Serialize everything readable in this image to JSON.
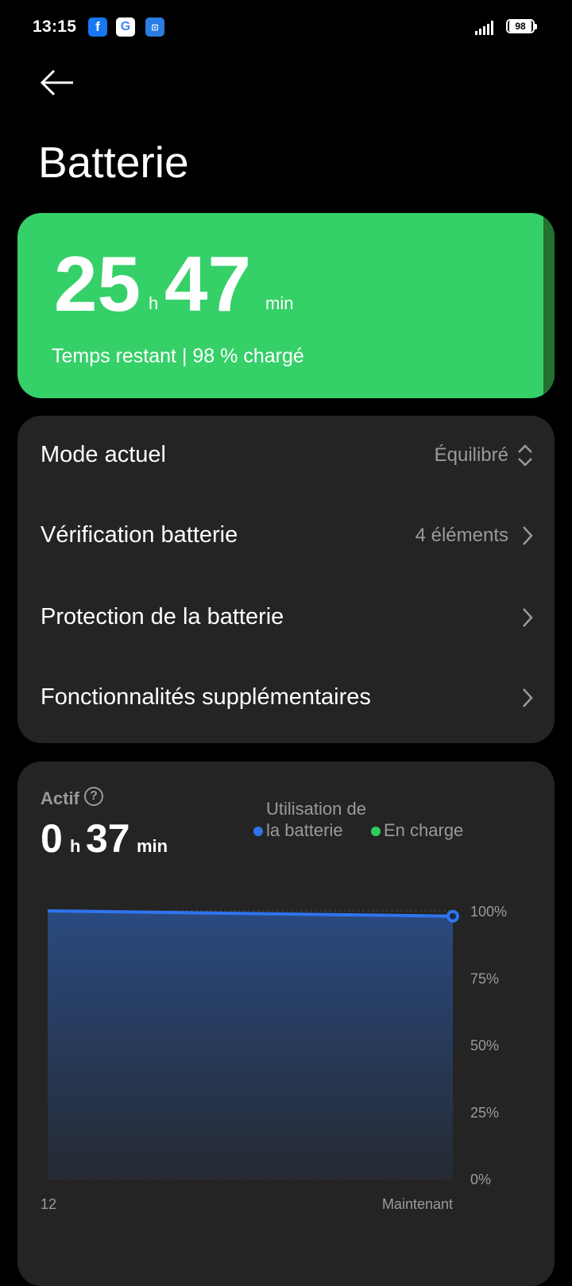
{
  "status_bar": {
    "time": "13:15",
    "battery_level": "98"
  },
  "page": {
    "title": "Batterie"
  },
  "summary": {
    "hours": "25",
    "hours_unit": "h",
    "minutes": "47",
    "minutes_unit": "min",
    "subtitle": "Temps restant | 98 % chargé"
  },
  "settings": [
    {
      "label": "Mode actuel",
      "value": "Équilibré"
    },
    {
      "label": "Vérification batterie",
      "value": "4 éléments"
    },
    {
      "label": "Protection de la batterie",
      "value": ""
    },
    {
      "label": "Fonctionnalités supplémentaires",
      "value": ""
    }
  ],
  "usage": {
    "label": "Actif",
    "hours": "0",
    "hours_unit": "h",
    "minutes": "37",
    "minutes_unit": "min",
    "legend_usage": "Utilisation de la batterie",
    "legend_charging": "En charge"
  },
  "colors": {
    "accent_green": "#35d068",
    "usage_blue": "#2f74ee",
    "charging_green": "#2ecc5d"
  },
  "chart_data": {
    "type": "area",
    "x_labels": [
      "12",
      "Maintenant"
    ],
    "y_ticks": [
      "100%",
      "75%",
      "50%",
      "25%",
      "0%"
    ],
    "ylim": [
      0,
      100
    ],
    "series": [
      {
        "name": "Utilisation de la batterie",
        "x": [
          "12",
          "Maintenant"
        ],
        "values": [
          100,
          98
        ]
      }
    ],
    "grid": true
  }
}
